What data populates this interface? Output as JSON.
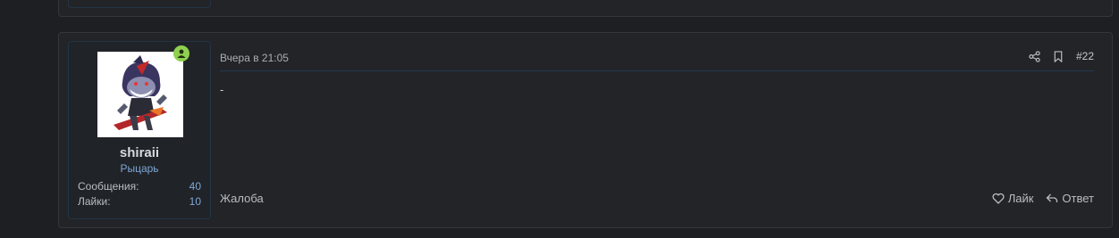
{
  "previous_post": {},
  "post": {
    "author": {
      "username": "shiraii",
      "title": "Рыцарь",
      "online": true,
      "stats": [
        {
          "label": "Сообщения:",
          "value": "40"
        },
        {
          "label": "Лайки:",
          "value": "10"
        }
      ]
    },
    "date": "Вчера в 21:05",
    "number": "#22",
    "body": "-",
    "report_label": "Жалоба",
    "like_label": "Лайк",
    "reply_label": "Ответ"
  },
  "colors": {
    "background": "#1d1f22",
    "card": "#222427",
    "accent_link": "#7fa6d8",
    "online": "#8fd14f"
  }
}
